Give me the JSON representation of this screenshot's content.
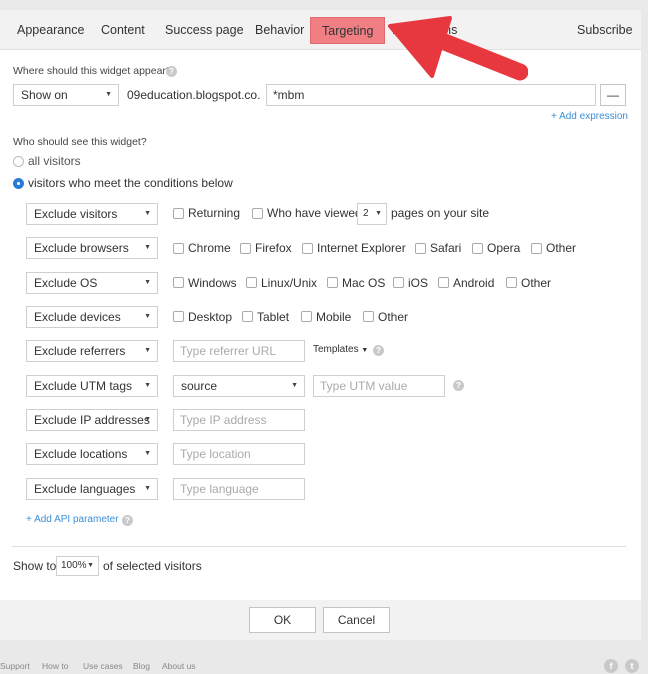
{
  "tabs": [
    "Appearance",
    "Content",
    "Success page",
    "Behavior",
    "Targeting",
    "Integrations",
    "Subscribe"
  ],
  "where": {
    "question": "Where should this widget appear?",
    "mode": "Show on",
    "domain": "09education.blogspot.co...",
    "expression": "*mbm",
    "remove_label": "—",
    "add_expression": "+ Add expression"
  },
  "who": {
    "question": "Who should see this widget?",
    "all_visitors": "all visitors",
    "conditions": "visitors who meet the conditions below"
  },
  "rules": {
    "visitors": {
      "select": "Exclude visitors",
      "returning": "Returning",
      "viewed": "Who have viewed",
      "pages_count": "2",
      "pages_suffix": "pages on your site"
    },
    "browsers": {
      "select": "Exclude browsers",
      "options": [
        "Chrome",
        "Firefox",
        "Internet Explorer",
        "Safari",
        "Opera",
        "Other"
      ]
    },
    "os": {
      "select": "Exclude OS",
      "options": [
        "Windows",
        "Linux/Unix",
        "Mac OS",
        "iOS",
        "Android",
        "Other"
      ]
    },
    "devices": {
      "select": "Exclude devices",
      "options": [
        "Desktop",
        "Tablet",
        "Mobile",
        "Other"
      ]
    },
    "referrers": {
      "select": "Exclude referrers",
      "placeholder": "Type referrer URL",
      "templates": "Templates"
    },
    "utm": {
      "select": "Exclude UTM tags",
      "param": "source",
      "placeholder": "Type UTM value"
    },
    "ip": {
      "select": "Exclude IP addresses",
      "placeholder": "Type IP address"
    },
    "locations": {
      "select": "Exclude locations",
      "placeholder": "Type location"
    },
    "languages": {
      "select": "Exclude languages",
      "placeholder": "Type language"
    }
  },
  "add_api": "+ Add API parameter",
  "show_to": {
    "prefix": "Show to",
    "value": "100%",
    "suffix": "of selected visitors"
  },
  "buttons": {
    "ok": "OK",
    "cancel": "Cancel"
  },
  "footer": [
    "Support",
    "How to",
    "Use cases",
    "Blog",
    "About us"
  ],
  "colors": {
    "active_tab": "#f07e82",
    "arrow": "#e8383f",
    "link": "#3b8fd6",
    "radio": "#2b7bd6"
  }
}
